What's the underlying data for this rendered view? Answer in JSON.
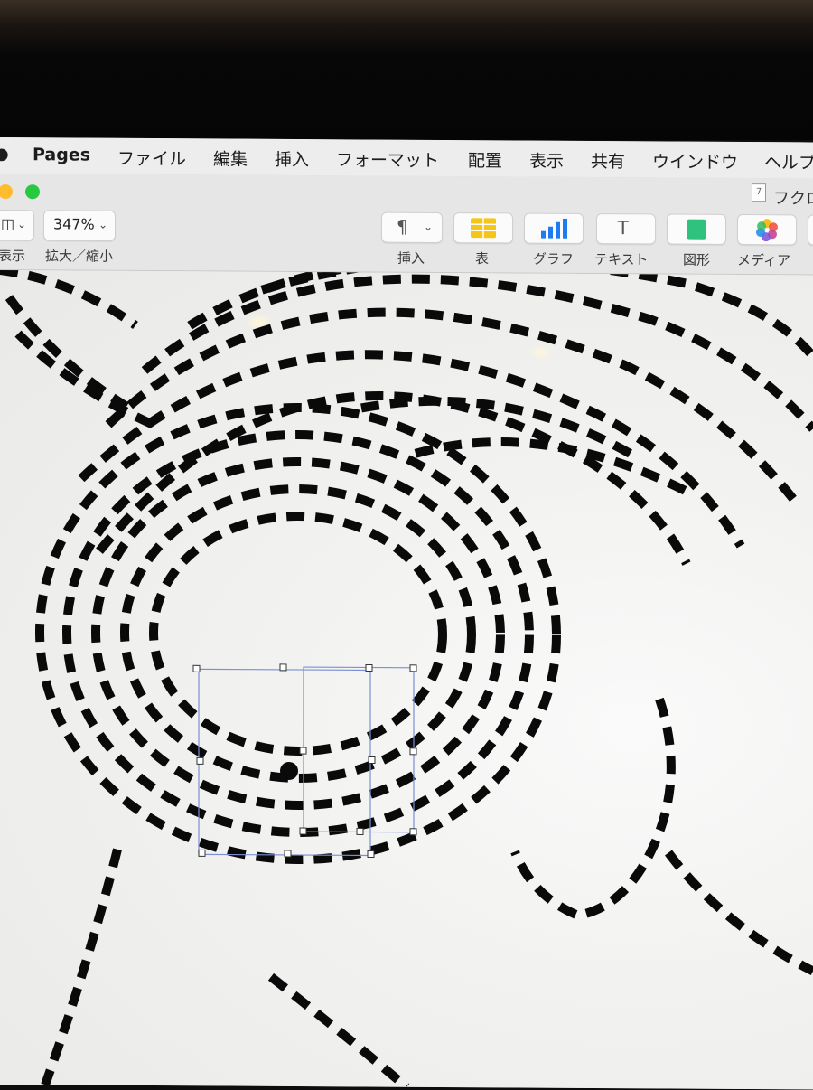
{
  "menubar": {
    "app_name": "Pages",
    "items": [
      "ファイル",
      "編集",
      "挿入",
      "フォーマット",
      "配置",
      "表示",
      "共有",
      "ウインドウ",
      "ヘルプ"
    ]
  },
  "window": {
    "document_title": "フクロ"
  },
  "toolbar": {
    "view_label": "表示",
    "zoom_value": "347%",
    "zoom_label": "拡大／縮小",
    "insert_label": "挿入",
    "table_label": "表",
    "chart_label": "グラフ",
    "text_label": "テキスト",
    "shape_label": "図形",
    "media_label": "メディア"
  },
  "colors": {
    "close": "#fe5f57",
    "minimize": "#febc2e",
    "zoom": "#28c840",
    "table_icon": "#f5c518",
    "chart_icon": "#1e7cf2",
    "shape_icon": "#2ec27e",
    "selection": "#7a8fd6"
  },
  "icons": [
    "paragraph-icon",
    "table-icon",
    "chart-icon",
    "text-icon",
    "shape-icon",
    "media-icon"
  ]
}
